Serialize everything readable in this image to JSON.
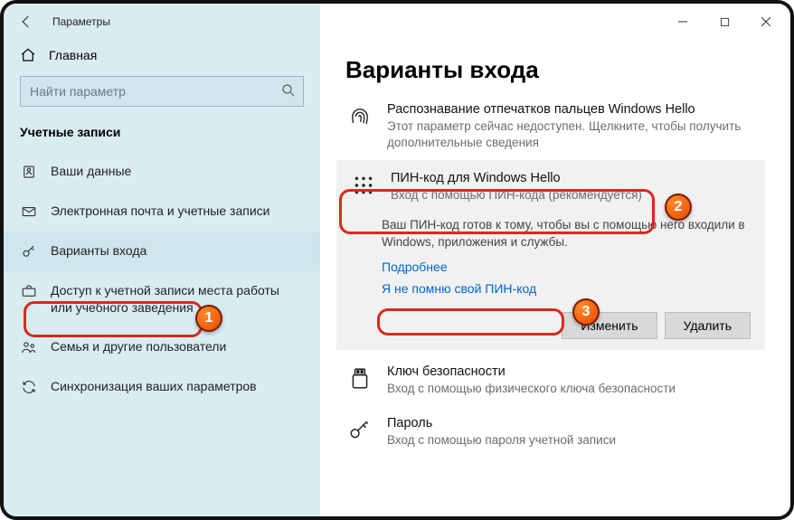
{
  "app_title": "Параметры",
  "home_label": "Главная",
  "search_placeholder": "Найти параметр",
  "section_title": "Учетные записи",
  "nav": {
    "your_info": "Ваши данные",
    "email": "Электронная почта и учетные записи",
    "signin": "Варианты входа",
    "work": "Доступ к учетной записи места работы или учебного заведения",
    "family": "Семья и другие пользователи",
    "sync": "Синхронизация ваших параметров"
  },
  "page_title": "Варианты входа",
  "options": {
    "fingerprint": {
      "title": "Распознавание отпечатков пальцев Windows Hello",
      "sub": "Этот параметр сейчас недоступен. Щелкните, чтобы получить дополнительные сведения"
    },
    "pin": {
      "title": "ПИН-код для Windows Hello",
      "sub": "Вход с помощью ПИН-кода (рекомендуется)",
      "desc": "Ваш ПИН-код готов к тому, чтобы вы с помощью него входили в Windows, приложения и службы.",
      "learn_more": "Подробнее",
      "forgot": "Я не помню свой ПИН-код",
      "change": "Изменить",
      "remove": "Удалить"
    },
    "security_key": {
      "title": "Ключ безопасности",
      "sub": "Вход с помощью физического ключа безопасности"
    },
    "password": {
      "title": "Пароль",
      "sub": "Вход с помощью пароля учетной записи"
    }
  },
  "badges": {
    "b1": "1",
    "b2": "2",
    "b3": "3"
  }
}
